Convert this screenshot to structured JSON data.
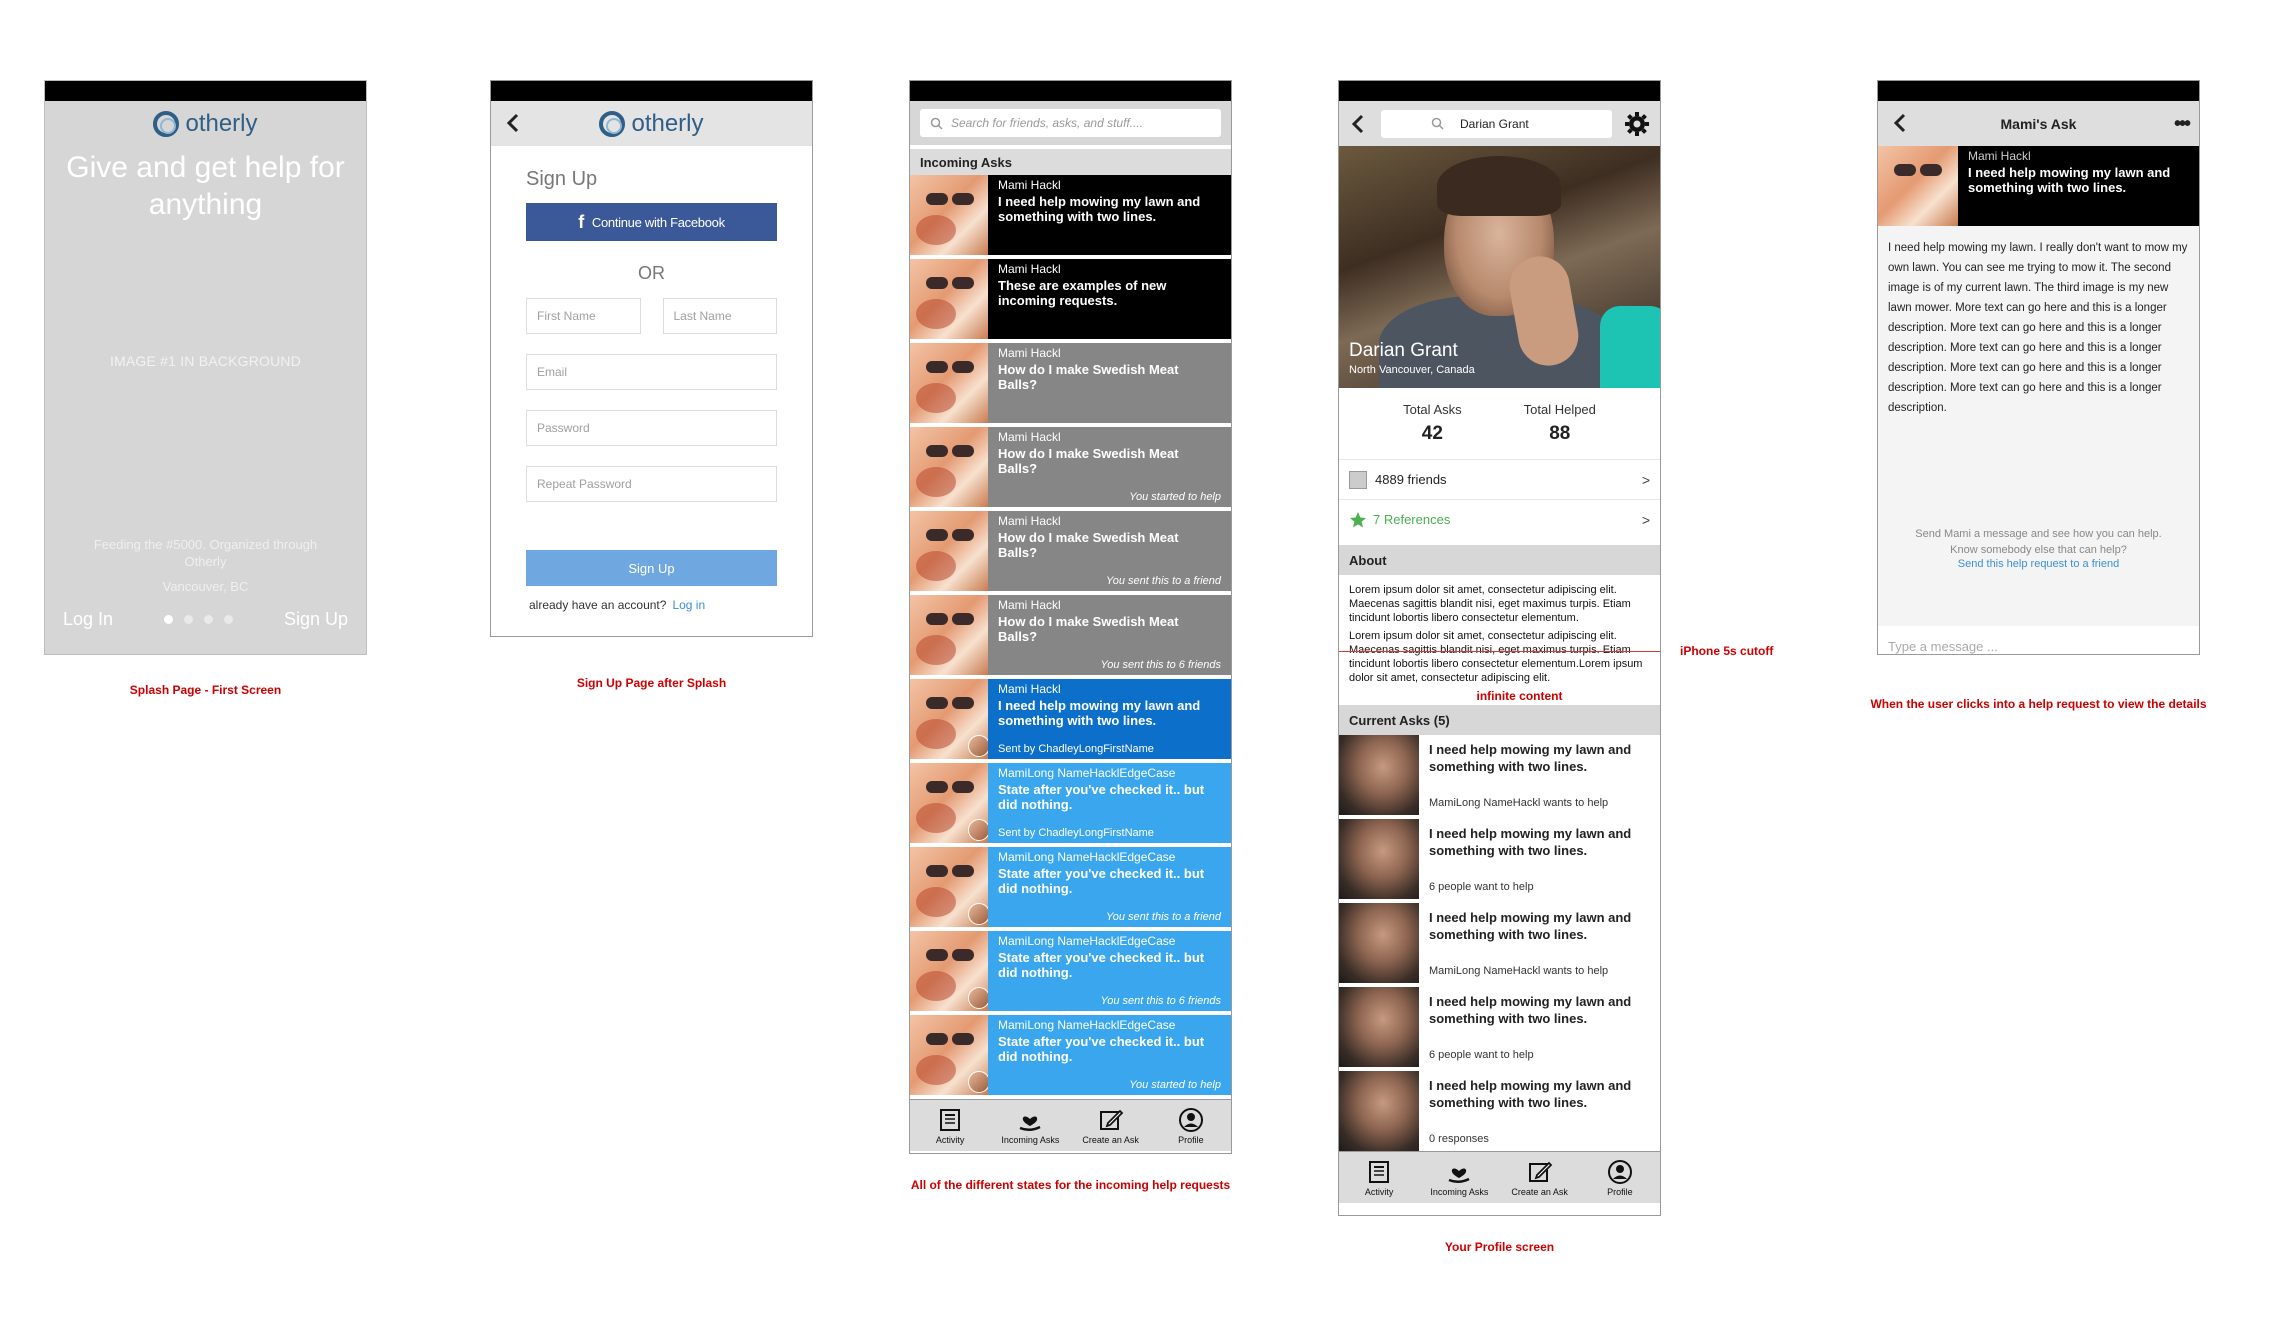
{
  "splash": {
    "logo_text": "otherly",
    "headline": "Give and get help for anything",
    "bg_label": "IMAGE #1 IN BACKGROUND",
    "feed_text": "Feeding the #5000. Organized through Otherly",
    "location": "Vancouver, BC",
    "login_label": "Log In",
    "signup_label": "Sign Up",
    "caption": "Splash Page - First Screen"
  },
  "signup": {
    "logo_text": "otherly",
    "title": "Sign Up",
    "facebook_label": "Continue with Facebook",
    "or_label": "OR",
    "first_name_placeholder": "First Name",
    "last_name_placeholder": "Last Name",
    "email_placeholder": "Email",
    "password_placeholder": "Password",
    "repeat_password_placeholder": "Repeat Password",
    "submit_label": "Sign Up",
    "already_text": "already have an account?",
    "login_link": "Log in",
    "caption": "Sign Up Page after Splash"
  },
  "incoming": {
    "search_placeholder": "Search for friends, asks, and stuff....",
    "section_title": "Incoming Asks",
    "asks": [
      {
        "name": "Mami Hackl",
        "text": "I need help mowing my lawn and something with two lines.",
        "status": "",
        "sent_by": "",
        "style": "black"
      },
      {
        "name": "Mami Hackl",
        "text": "These are examples of new incoming requests.",
        "status": "",
        "sent_by": "",
        "style": "black"
      },
      {
        "name": "Mami Hackl",
        "text": "How do I make Swedish Meat Balls?",
        "status": "",
        "sent_by": "",
        "style": "gray"
      },
      {
        "name": "Mami Hackl",
        "text": "How do I make Swedish Meat Balls?",
        "status": "You started to help",
        "sent_by": "",
        "style": "gray"
      },
      {
        "name": "Mami Hackl",
        "text": "How do I make Swedish Meat Balls?",
        "status": "You sent this to a friend",
        "sent_by": "",
        "style": "gray"
      },
      {
        "name": "Mami Hackl",
        "text": "How do I make Swedish Meat Balls?",
        "status": "You sent this to 6 friends",
        "sent_by": "",
        "style": "gray"
      },
      {
        "name": "Mami Hackl",
        "text": "I need help mowing my lawn and something with two lines.",
        "status": "",
        "sent_by": "Sent by ChadleyLongFirstName",
        "style": "darkblue"
      },
      {
        "name": "MamiLong NameHacklEdgeCase",
        "text": "State after you've checked it.. but did nothing.",
        "status": "",
        "sent_by": "Sent by ChadleyLongFirstName",
        "style": "lightblue"
      },
      {
        "name": "MamiLong NameHacklEdgeCase",
        "text": "State after you've checked it.. but did nothing.",
        "status": "You sent this to a friend",
        "sent_by": "",
        "style": "lightblue"
      },
      {
        "name": "MamiLong NameHacklEdgeCase",
        "text": "State after you've checked it.. but did nothing.",
        "status": "You sent this to 6 friends",
        "sent_by": "",
        "style": "lightblue"
      },
      {
        "name": "MamiLong NameHacklEdgeCase",
        "text": "State after you've checked it.. but did nothing.",
        "status": "You started to help",
        "sent_by": "",
        "style": "lightblue"
      }
    ],
    "caption": "All of the different states for the incoming help requests"
  },
  "tabbar": {
    "activity": "Activity",
    "incoming": "Incoming Asks",
    "create": "Create an Ask",
    "profile": "Profile"
  },
  "profile": {
    "search_value": "Darian Grant",
    "name": "Darian Grant",
    "location": "North Vancouver, Canada",
    "total_asks_label": "Total Asks",
    "total_asks": "42",
    "total_helped_label": "Total Helped",
    "total_helped": "88",
    "friends": "4889 friends",
    "references": "7 References",
    "about_title": "About",
    "about_p1": "Lorem ipsum dolor sit amet, consectetur adipiscing elit. Maecenas sagittis blandit nisi, eget maximus turpis. Etiam tincidunt lobortis libero consectetur elementum.",
    "about_p2": "Lorem ipsum dolor sit amet, consectetur adipiscing elit. Maecenas sagittis blandit nisi, eget maximus turpis. Etiam tincidunt lobortis libero consectetur elementum.Lorem ipsum dolor sit amet, consectetur adipiscing elit.",
    "cutoff_label": "iPhone 5s cutoff",
    "infinite_label": "infinite content",
    "current_asks_title": "Current Asks (5)",
    "current_asks": [
      {
        "title": "I need help mowing my lawn and something with two lines.",
        "meta": "MamiLong NameHackl wants to help"
      },
      {
        "title": "I need help mowing my lawn and something with two lines.",
        "meta": "6 people want to help"
      },
      {
        "title": "I need help mowing my lawn and something with two lines.",
        "meta": "MamiLong NameHackl wants to help"
      },
      {
        "title": "I need help mowing my lawn and something with two lines.",
        "meta": "6 people want to help"
      },
      {
        "title": "I need help mowing my lawn and something with two lines.",
        "meta": "0 responses"
      }
    ],
    "caption": "Your Profile screen"
  },
  "detail": {
    "title": "Mami's Ask",
    "name": "Mami Hackl",
    "ask_text": "I need help mowing my lawn and something with two lines.",
    "description": "I need help mowing my lawn. I really don't want to mow my own lawn. You can see me trying to mow it. The second image is of my current lawn.  The third image is my new lawn mower. More text can go here and this is a longer description. More text can go here and this is a longer description. More text can go here and this is a longer description. More text can go here and this is a longer description. More text can go here and this is a longer description.",
    "msg_hint": "Send Mami a message and see how you can help.",
    "know_somebody": "Know somebody else that can help?",
    "send_link": "Send this help request to a friend",
    "type_placeholder": "Type a message ...",
    "caption": "When the user clicks into a help request to view the details"
  }
}
